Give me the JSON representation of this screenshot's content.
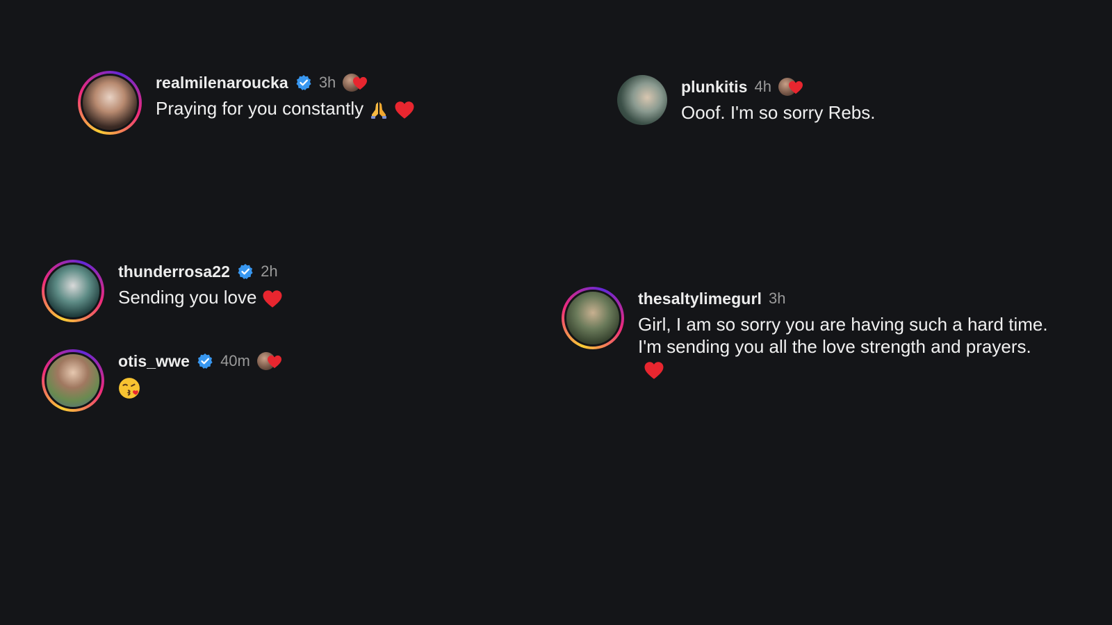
{
  "comments": [
    {
      "username": "realmilenaroucka",
      "verified": true,
      "time": "3h",
      "liked_by_author": true,
      "text": "Praying for you constantly",
      "emojis": [
        "folded-hands",
        "red-heart"
      ]
    },
    {
      "username": "plunkitis",
      "verified": false,
      "time": "4h",
      "liked_by_author": true,
      "text": "Ooof. I'm so sorry Rebs.",
      "emojis": []
    },
    {
      "username": "thunderrosa22",
      "verified": true,
      "time": "2h",
      "liked_by_author": false,
      "text": "Sending you love",
      "emojis": [
        "red-heart"
      ]
    },
    {
      "username": "otis_wwe",
      "verified": true,
      "time": "40m",
      "liked_by_author": true,
      "text": "",
      "emojis": [
        "face-blowing-kiss"
      ]
    },
    {
      "username": "thesaltylimegurl",
      "verified": false,
      "time": "3h",
      "liked_by_author": false,
      "text": "Girl, I am so sorry you are having such a hard time. I'm sending you all the love strength and prayers.",
      "emojis": [
        "red-heart"
      ]
    }
  ],
  "colors": {
    "background": "#141518",
    "verified_badge": "#3897f0",
    "heart": "#e8262f",
    "muted_text": "#9a9a9a"
  }
}
